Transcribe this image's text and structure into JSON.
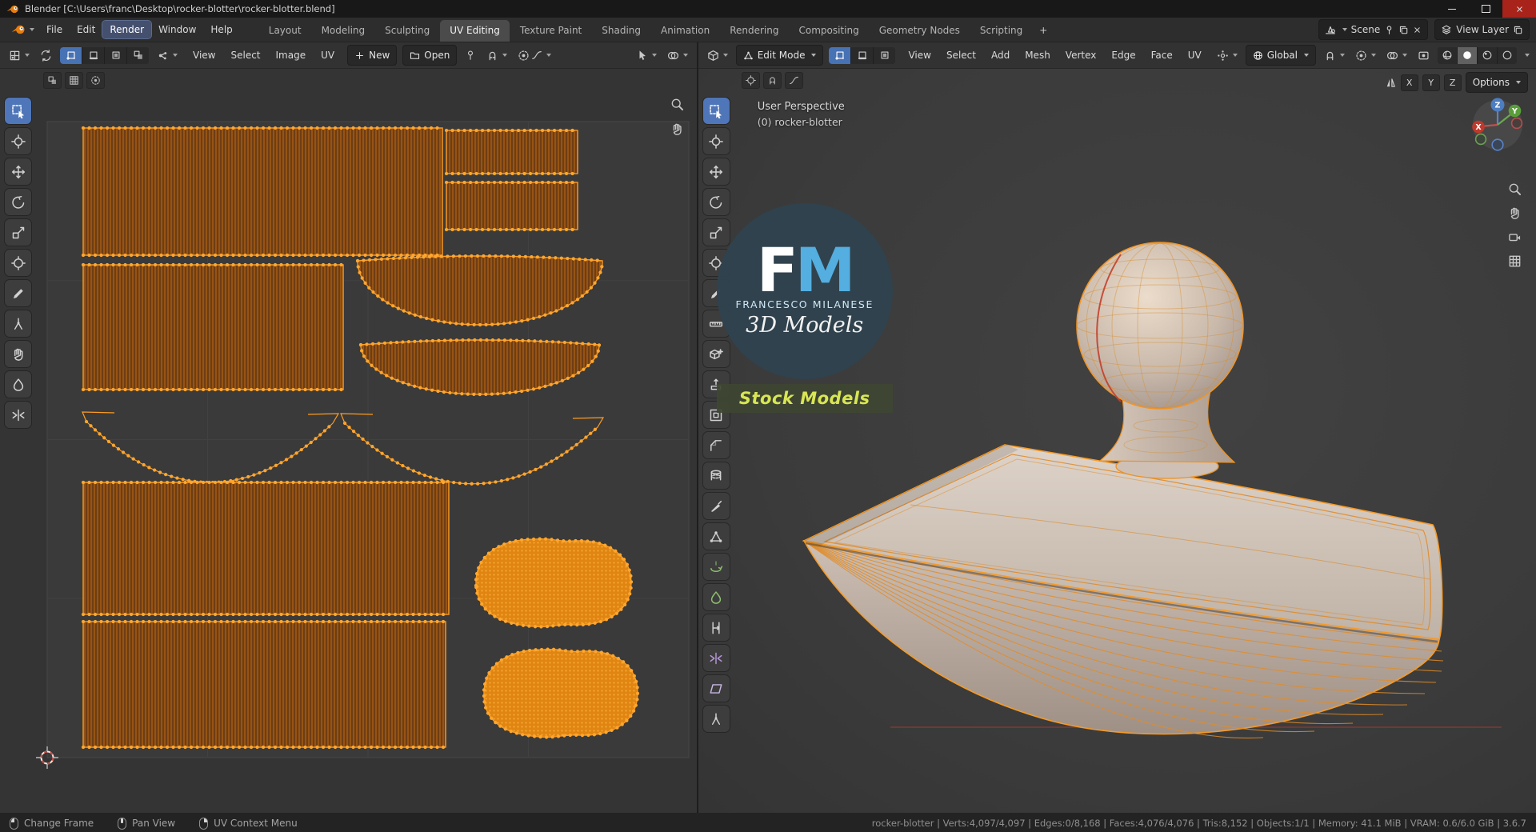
{
  "window": {
    "title": "Blender [C:\\Users\\franc\\Desktop\\rocker-blotter\\rocker-blotter.blend]"
  },
  "topbar": {
    "menus": [
      "File",
      "Edit",
      "Render",
      "Window",
      "Help"
    ],
    "workspaces": [
      "Layout",
      "Modeling",
      "Sculpting",
      "UV Editing",
      "Texture Paint",
      "Shading",
      "Animation",
      "Rendering",
      "Compositing",
      "Geometry Nodes",
      "Scripting"
    ],
    "add_tab": "+",
    "scene": "Scene",
    "view_layer": "View Layer"
  },
  "uv": {
    "menus": [
      "View",
      "Select",
      "Image",
      "UV"
    ],
    "new": "New",
    "open": "Open"
  },
  "vp": {
    "mode": "Edit Mode",
    "menus": [
      "View",
      "Select",
      "Add",
      "Mesh",
      "Vertex",
      "Edge",
      "Face",
      "UV"
    ],
    "orientation": "Global",
    "persp": "User Perspective",
    "object": "(0) rocker-blotter",
    "options": "Options",
    "x": "X",
    "y": "Y",
    "z": "Z"
  },
  "wm": {
    "f": "F",
    "m": "M",
    "name": "FRANCESCO MILANESE",
    "models": "3D Models",
    "stock": "Stock Models"
  },
  "status": {
    "items": [
      "Change Frame",
      "Pan View",
      "UV Context Menu"
    ],
    "stats": "rocker-blotter | Verts:4,097/4,097 | Edges:0/8,168 | Faces:4,076/4,076 | Tris:8,152 | Objects:1/1 | Memory: 41.1 MiB | VRAM: 0.6/6.0 GiB | 3.6.7"
  },
  "colors": {
    "accent_blue": "#4772b3",
    "selection_orange": "#ff9d23",
    "wm_blue": "#54aee0",
    "stock_green": "#d9e654"
  }
}
